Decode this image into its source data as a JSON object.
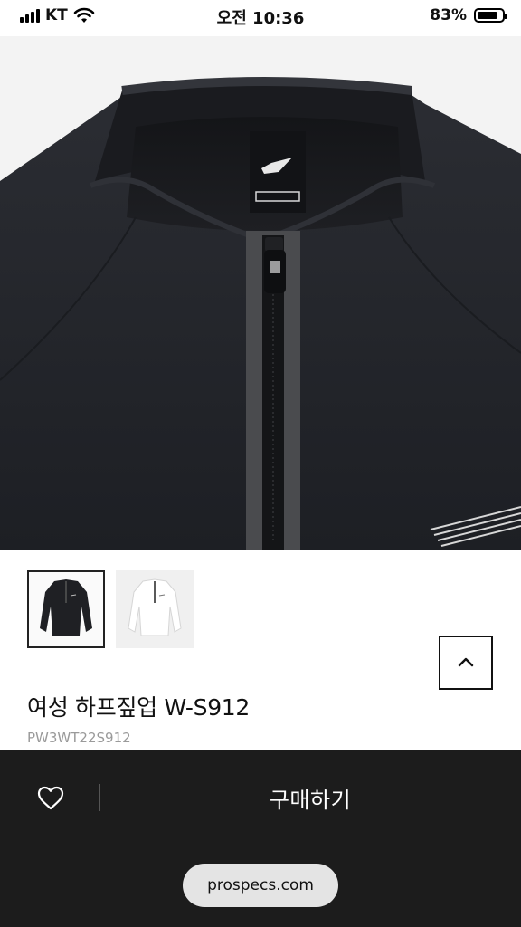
{
  "status_bar": {
    "carrier": "KT",
    "time": "오전 10:36",
    "battery_percent": "83%",
    "battery_level": 0.83
  },
  "product": {
    "name": "여성 하프짚업 W-S912",
    "code": "PW3WT22S912"
  },
  "thumbnails": [
    {
      "name": "black-jacket-thumbnail",
      "selected": true
    },
    {
      "name": "white-jacket-thumbnail",
      "selected": false
    }
  ],
  "actions": {
    "buy_label": "구매하기",
    "wishlist_icon": "heart-icon",
    "scroll_top_icon": "chevron-up-icon"
  },
  "browser": {
    "url": "prospecs.com"
  },
  "colors": {
    "bottom_bar": "#1c1c1c",
    "garment": "#23252b"
  }
}
